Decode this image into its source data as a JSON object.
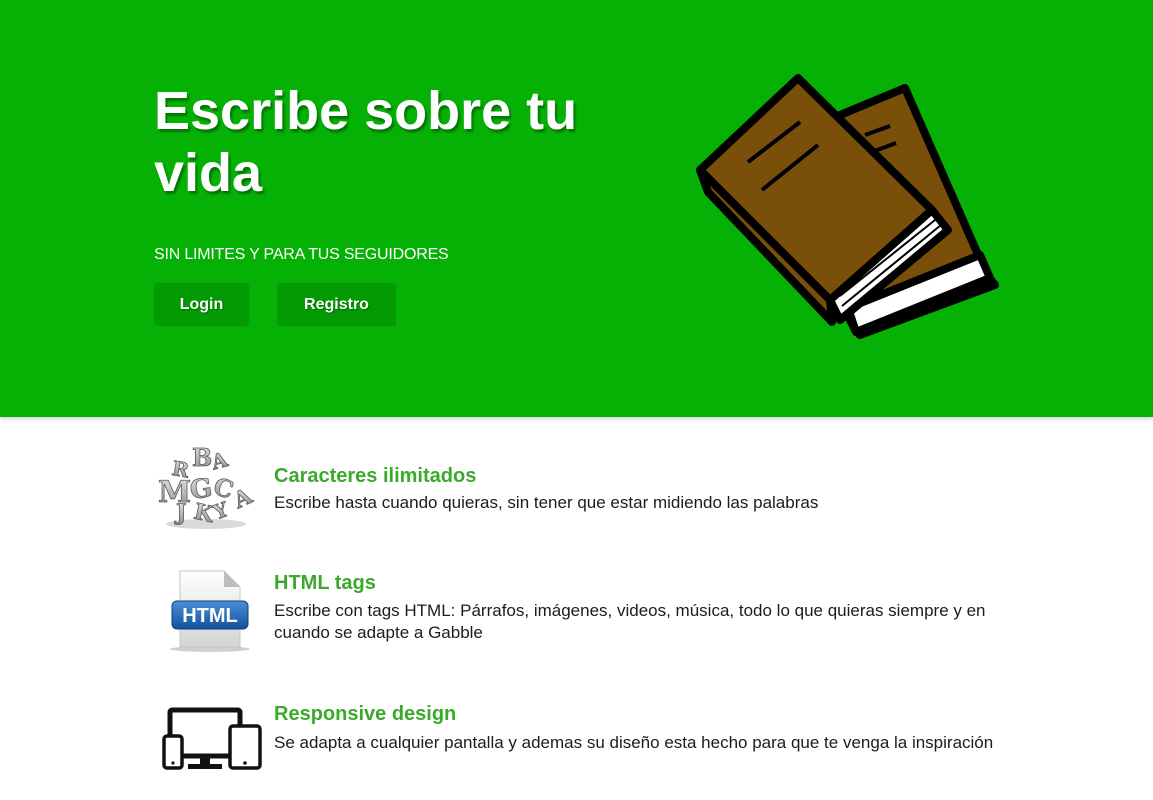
{
  "hero": {
    "title": "Escribe sobre tu vida",
    "subtitle": "SIN LIMITES Y PARA TUS SEGUIDORES",
    "login_label": "Login",
    "register_label": "Registro",
    "illustration_icon": "books-icon",
    "background_color": "#06b106",
    "button_color": "#049a04"
  },
  "features": [
    {
      "icon": "letters-icon",
      "title": "Caracteres ilimitados",
      "description": "Escribe hasta cuando quieras, sin tener que estar midiendo las palabras"
    },
    {
      "icon": "html-file-icon",
      "icon_text": "HTML",
      "title": "HTML tags",
      "description": "Escribe con tags HTML: Párrafos, imágenes, videos, música, todo lo que quieras siempre y en cuando se adapte a Gabble"
    },
    {
      "icon": "devices-icon",
      "title": "Responsive design",
      "description": "Se adapta a cualquier pantalla y ademas su diseño esta hecho para que te venga la inspiración"
    }
  ],
  "colors": {
    "feature_title": "#3aaa2a",
    "text": "#1c1c1c"
  }
}
